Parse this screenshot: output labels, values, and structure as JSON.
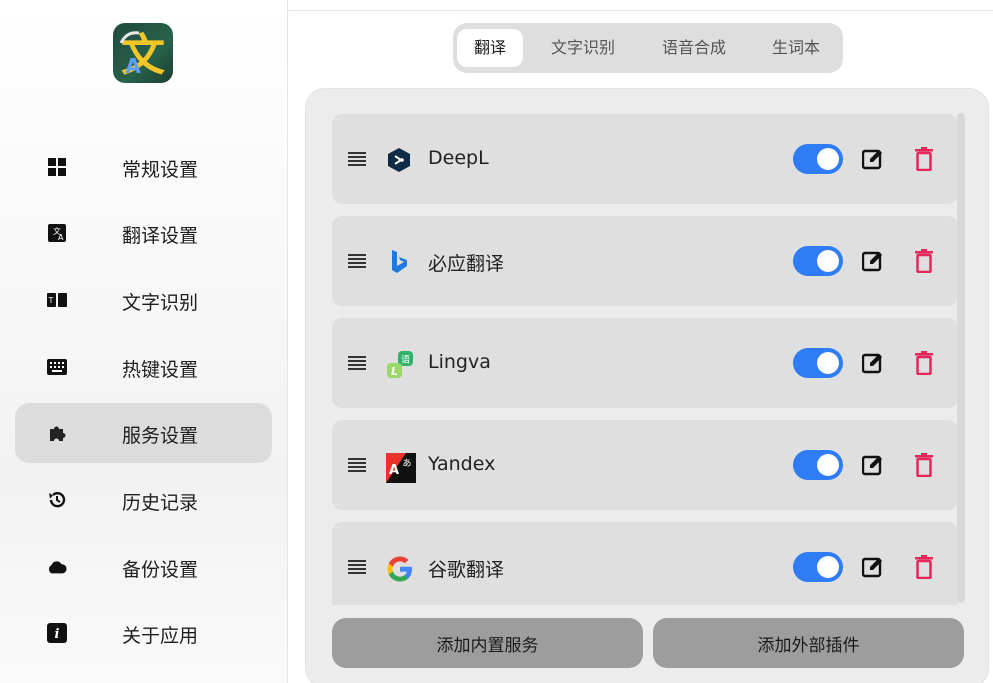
{
  "sidebar": {
    "items": [
      {
        "label": "常规设置",
        "icon": "grid-icon"
      },
      {
        "label": "翻译设置",
        "icon": "translate-icon"
      },
      {
        "label": "文字识别",
        "icon": "ocr-icon"
      },
      {
        "label": "热键设置",
        "icon": "keyboard-icon"
      },
      {
        "label": "服务设置",
        "icon": "puzzle-icon",
        "active": true
      },
      {
        "label": "历史记录",
        "icon": "history-icon"
      },
      {
        "label": "备份设置",
        "icon": "cloud-icon"
      },
      {
        "label": "关于应用",
        "icon": "info-icon"
      }
    ]
  },
  "tabs": [
    {
      "label": "翻译",
      "active": true
    },
    {
      "label": "文字识别"
    },
    {
      "label": "语音合成"
    },
    {
      "label": "生词本"
    }
  ],
  "services": [
    {
      "name": "DeepL",
      "icon": "deepl-icon",
      "enabled": true
    },
    {
      "name": "必应翻译",
      "icon": "bing-icon",
      "enabled": true
    },
    {
      "name": "Lingva",
      "icon": "lingva-icon",
      "enabled": true
    },
    {
      "name": "Yandex",
      "icon": "yandex-icon",
      "enabled": true
    },
    {
      "name": "谷歌翻译",
      "icon": "google-icon",
      "enabled": true
    }
  ],
  "buttons": {
    "add_builtin": "添加内置服务",
    "add_plugin": "添加外部插件"
  },
  "colors": {
    "toggle_on": "#2e7cf6",
    "delete": "#e5265b",
    "active_nav": "#dcdcdc",
    "bottom_button": "#9d9d9d"
  }
}
